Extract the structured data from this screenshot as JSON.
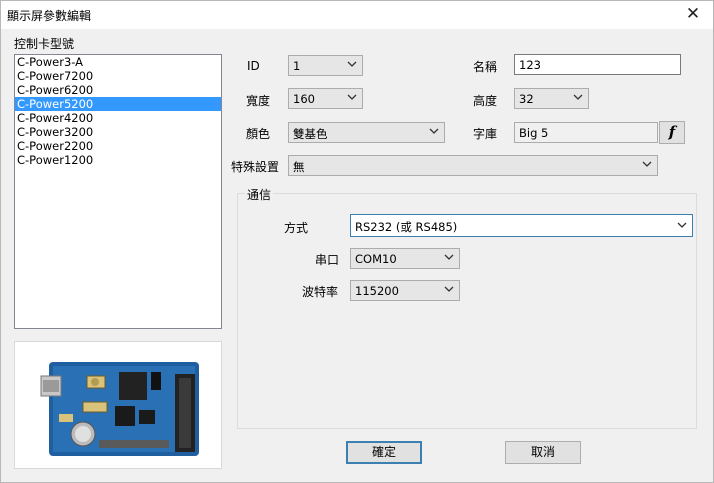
{
  "window": {
    "title": "顯示屏參數編輯"
  },
  "controller": {
    "label": "控制卡型號",
    "items": [
      "C-Power3-A",
      "C-Power7200",
      "C-Power6200",
      "C-Power5200",
      "C-Power4200",
      "C-Power3200",
      "C-Power2200",
      "C-Power1200"
    ],
    "selected_index": 3
  },
  "fields": {
    "id_label": "ID",
    "id_value": "1",
    "name_label": "名稱",
    "name_value": "123",
    "width_label": "寬度",
    "width_value": "160",
    "height_label": "高度",
    "height_value": "32",
    "color_label": "顏色",
    "color_value": "雙基色",
    "font_label": "字庫",
    "font_value": "Big 5",
    "font_button": "f",
    "special_label": "特殊設置",
    "special_value": "無"
  },
  "comm": {
    "group_label": "通信",
    "mode_label": "方式",
    "mode_value": "RS232 (或 RS485)",
    "port_label": "串口",
    "port_value": "COM10",
    "baud_label": "波特率",
    "baud_value": "115200"
  },
  "buttons": {
    "ok": "確定",
    "cancel": "取消"
  },
  "colors": {
    "selection": "#3399ff",
    "focus_border": "#3c7fb1"
  }
}
